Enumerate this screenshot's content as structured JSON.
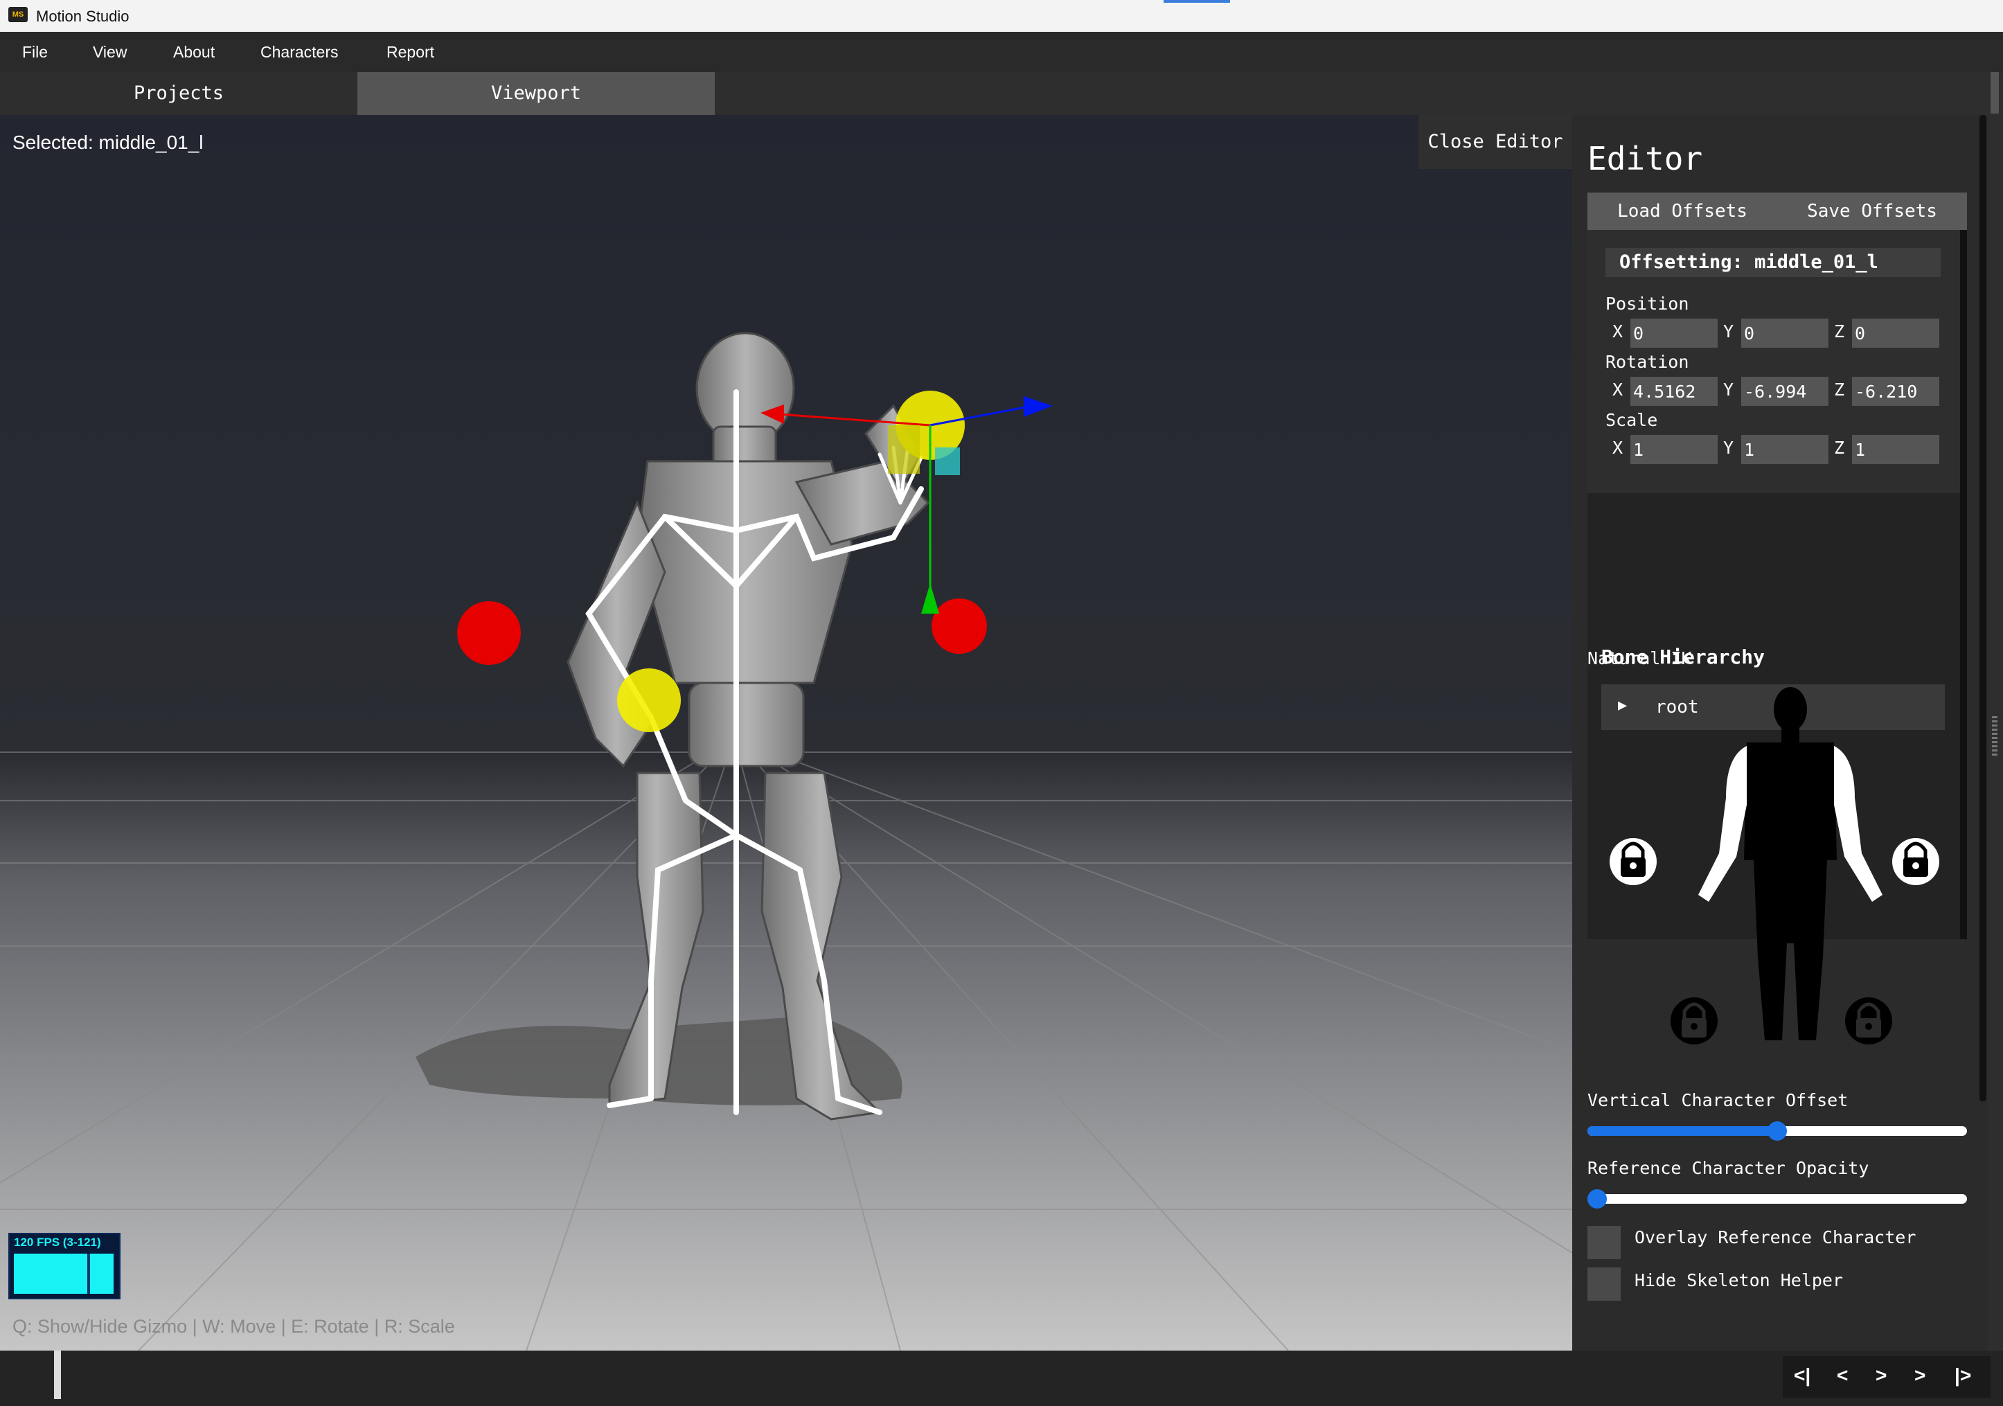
{
  "app": {
    "title": "Motion Studio",
    "icon_text": "MS"
  },
  "menu": {
    "items": [
      "File",
      "View",
      "About",
      "Characters",
      "Report"
    ]
  },
  "tabs": [
    {
      "label": "Projects",
      "active": false
    },
    {
      "label": "Viewport",
      "active": true
    }
  ],
  "viewport": {
    "selected_label": "Selected: middle_01_l",
    "close_editor_label": "Close Editor",
    "fps_text": "120 FPS (3-121)",
    "hint": "Q: Show/Hide Gizmo | W: Move | E: Rotate | R: Scale",
    "colors": {
      "bone_target": "#e00000",
      "bone_joint": "#f5f000",
      "gizmo_x": "#e00000",
      "gizmo_y": "#00c800",
      "gizmo_z": "#0018f0"
    }
  },
  "editor": {
    "title": "Editor",
    "load_offsets": "Load Offsets",
    "save_offsets": "Save Offsets",
    "offsetting_label": "Offsetting: middle_01_l",
    "position": {
      "label": "Position",
      "x": "0",
      "y": "0",
      "z": "0"
    },
    "rotation": {
      "label": "Rotation",
      "x": "4.5162",
      "y": "-6.994",
      "z": "-6.210"
    },
    "scale": {
      "label": "Scale",
      "x": "1",
      "y": "1",
      "z": "1"
    },
    "axis_labels": {
      "x": "X",
      "y": "Y",
      "z": "Z"
    },
    "bone_hierarchy": {
      "title": "Bone Hierarchy",
      "root_label": "root",
      "expand_icon": "play-arrow-icon"
    },
    "natural_ik_label": "Natural IK",
    "ik_locks": [
      "left-hand-lock-icon",
      "right-hand-lock-icon",
      "left-foot-lock-icon",
      "right-foot-lock-icon"
    ],
    "vertical_offset": {
      "label": "Vertical Character Offset",
      "value_fraction": 0.5
    },
    "reference_opacity": {
      "label": "Reference Character Opacity",
      "value_fraction": 0.0
    },
    "overlay_reference": {
      "label": "Overlay Reference Character",
      "checked": false
    },
    "hide_skeleton": {
      "label": "Hide Skeleton Helper",
      "checked": false
    },
    "accent_color": "#1a73e8"
  },
  "timeline": {
    "controls": [
      "<|",
      "<",
      ">",
      ">",
      "|>"
    ]
  }
}
